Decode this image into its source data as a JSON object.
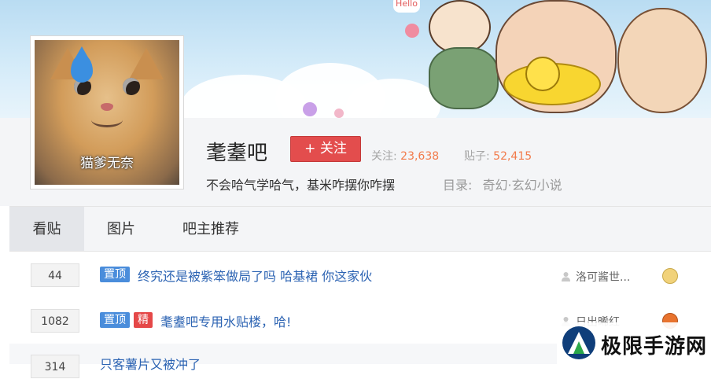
{
  "banner": {
    "avatar_caption": "猫爹无奈",
    "artwork_lettering": "Hello"
  },
  "forum": {
    "name": "耄耋吧",
    "follow_label": "+ 关注",
    "followers_label": "关注:",
    "followers_count": "23,638",
    "posts_label": "贴子:",
    "posts_count": "52,415",
    "slogan": "不会哈气学哈气，基米咋摆你咋摆",
    "category_label": "目录:",
    "category_value": "奇幻·玄幻小说"
  },
  "tabs": [
    {
      "label": "看贴",
      "active": true
    },
    {
      "label": "图片",
      "active": false
    },
    {
      "label": "吧主推荐",
      "active": false
    }
  ],
  "threads": [
    {
      "replies": "44",
      "badges": [
        "置顶"
      ],
      "title": "终究还是被紫笨做局了吗 哈基裙 你这家伙",
      "author": "洛可酱世..."
    },
    {
      "replies": "1082",
      "badges": [
        "置顶",
        "精"
      ],
      "title": "耄耋吧专用水贴楼，哈!",
      "author": "日出晞红"
    },
    {
      "replies": "314",
      "badges": [],
      "title": "只客薯片又被冲了",
      "author": ""
    }
  ],
  "watermark": {
    "text": "极限手游网"
  },
  "colors": {
    "accent_red": "#e34d4d",
    "stat_number": "#f27b4b",
    "link_blue": "#2d64b3",
    "badge_blue": "#4a8ddb",
    "badge_red": "#e54848"
  },
  "icons": {
    "follow": "plus-icon",
    "author": "user-icon",
    "watermark_logo": "mountain-logo-icon"
  }
}
